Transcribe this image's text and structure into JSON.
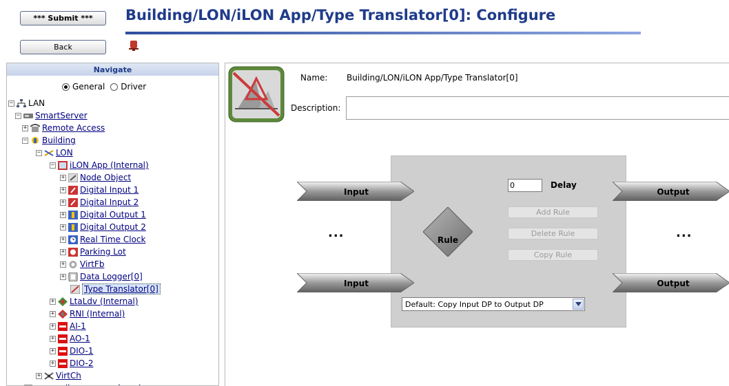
{
  "header": {
    "submit_label": "*** Submit ***",
    "back_label": "Back",
    "title": "Building/LON/iLON App/Type Translator[0]: Configure"
  },
  "nav": {
    "title": "Navigate",
    "radio_general": "General",
    "radio_driver": "Driver",
    "selected_radio": "General",
    "tree": [
      {
        "label": "LAN",
        "icon": "network-icon",
        "expander": "minus"
      },
      {
        "label": "SmartServer",
        "icon": "server-icon",
        "expander": "minus"
      },
      {
        "label": "Remote Access",
        "icon": "phone-icon",
        "expander": "plus"
      },
      {
        "label": "Building",
        "icon": "building-icon",
        "expander": "minus"
      },
      {
        "label": "LON",
        "icon": "lon-icon",
        "expander": "minus"
      },
      {
        "label": "iLON App (Internal)",
        "icon": "app-icon",
        "expander": "minus"
      },
      {
        "label": "Node Object",
        "icon": "node-object-icon",
        "expander": "plus"
      },
      {
        "label": "Digital Input 1",
        "icon": "digital-input-icon",
        "expander": "plus"
      },
      {
        "label": "Digital Input 2",
        "icon": "digital-input-icon",
        "expander": "plus"
      },
      {
        "label": "Digital Output 1",
        "icon": "digital-output-icon",
        "expander": "plus"
      },
      {
        "label": "Digital Output 2",
        "icon": "digital-output-icon",
        "expander": "plus"
      },
      {
        "label": "Real Time Clock",
        "icon": "clock-icon",
        "expander": "plus"
      },
      {
        "label": "Parking Lot",
        "icon": "parking-icon",
        "expander": "plus"
      },
      {
        "label": "VirtFb",
        "icon": "virtfb-icon",
        "expander": "plus"
      },
      {
        "label": "Data Logger[0]",
        "icon": "data-logger-icon",
        "expander": "plus"
      },
      {
        "label": "Type Translator[0]",
        "icon": "type-translator-icon",
        "expander": "none",
        "selected": true
      },
      {
        "label": "LtaLdv (Internal)",
        "icon": "ltaldv-icon",
        "expander": "plus"
      },
      {
        "label": "RNI (Internal)",
        "icon": "rni-icon",
        "expander": "plus"
      },
      {
        "label": "AI-1",
        "icon": "device-icon",
        "expander": "plus"
      },
      {
        "label": "AO-1",
        "icon": "device-icon",
        "expander": "plus"
      },
      {
        "label": "DIO-1",
        "icon": "device-icon",
        "expander": "plus"
      },
      {
        "label": "DIO-2",
        "icon": "device-icon",
        "expander": "plus"
      },
      {
        "label": "VirtCh",
        "icon": "virtch-icon",
        "expander": "plus"
      },
      {
        "label": "my_mailserver.my_domain.com",
        "icon": "computer-icon",
        "expander": "plus"
      }
    ]
  },
  "form": {
    "name_label": "Name:",
    "name_value": "Building/LON/iLON App/Type Translator[0]",
    "description_label": "Description:",
    "description_value": ""
  },
  "translator": {
    "input_label": "Input",
    "output_label": "Output",
    "ellipsis": "...",
    "rule_label": "Rule",
    "delay_value": "0",
    "delay_label": "Delay",
    "add_rule_label": "Add Rule",
    "delete_rule_label": "Delete Rule",
    "copy_rule_label": "Copy Rule",
    "rule_select_value": "Default: Copy Input DP to Output DP"
  },
  "colors": {
    "title": "#1f3b8a",
    "panel": "#cfcfcf",
    "link": "#000080",
    "alarm": "#c0392b"
  }
}
